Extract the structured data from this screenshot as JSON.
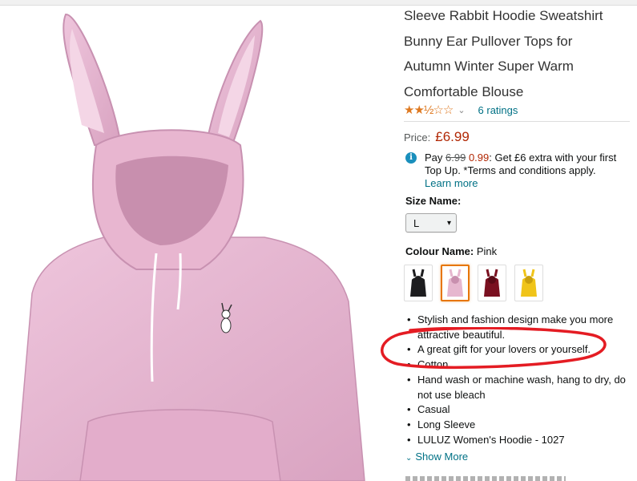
{
  "product": {
    "title_lines": [
      "Sleeve Rabbit Hoodie Sweatshirt",
      "Bunny Ear Pullover Tops for",
      "Autumn Winter Super Warm",
      "Comfortable Blouse"
    ],
    "rating_stars": 2.5,
    "ratings_text": "6 ratings",
    "image_color": "#e7b9d2"
  },
  "price": {
    "label": "Price:",
    "value": "£6.99"
  },
  "promo": {
    "prefix": "Pay ",
    "old": "6.99",
    "new": "0.99",
    "text": ": Get £6 extra with your first Top Up. *Terms and conditions apply.",
    "link": "Learn more"
  },
  "size": {
    "label": "Size Name:",
    "selected": "L"
  },
  "colour": {
    "label": "Colour Name:",
    "selected": "Pink",
    "swatches": [
      {
        "name": "Black",
        "hex": "#1d1d1f"
      },
      {
        "name": "Pink",
        "hex": "#e6b7cf"
      },
      {
        "name": "Red",
        "hex": "#7a1020"
      },
      {
        "name": "Yellow",
        "hex": "#f0c419"
      }
    ]
  },
  "bullets": [
    "Stylish and fashion design make you more attractive beautiful.",
    "A great gift for your lovers or yourself.",
    "Cotton",
    "Hand wash or machine wash, hang to dry, do not use bleach",
    "Casual",
    "Long Sleeve",
    "LULUZ Women's Hoodie - 1027"
  ],
  "show_more": "Show More",
  "colors": {
    "link": "#007185",
    "price": "#b12704",
    "star": "#de7921",
    "annotation": "#e41c23",
    "swatch_selected_border": "#e77600"
  }
}
